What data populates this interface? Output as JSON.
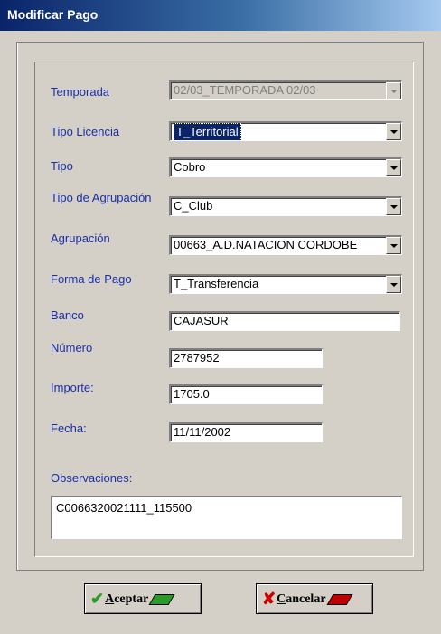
{
  "window": {
    "title": "Modificar Pago"
  },
  "form": {
    "temporada": {
      "label": "Temporada",
      "value": "02/03_TEMPORADA 02/03"
    },
    "tipo_licencia": {
      "label": "Tipo Licencia",
      "value": "T_Territorial"
    },
    "tipo": {
      "label": "Tipo",
      "value": "Cobro"
    },
    "tipo_agrupacion": {
      "label": "Tipo de Agrupación",
      "value": "C_Club"
    },
    "agrupacion": {
      "label": "Agrupación",
      "value": "00663_A.D.NATACION CORDOBE"
    },
    "forma_pago": {
      "label": "Forma de Pago",
      "value": "T_Transferencia"
    },
    "banco": {
      "label": "Banco",
      "value": "CAJASUR"
    },
    "numero": {
      "label": "Número",
      "value": "2787952"
    },
    "importe": {
      "label": "Importe:",
      "value": "1705.0"
    },
    "fecha": {
      "label": "Fecha:",
      "value": "11/11/2002"
    },
    "observaciones": {
      "label": "Observaciones:",
      "value": "C0066320021111_115500"
    }
  },
  "buttons": {
    "accept_first": "A",
    "accept_rest": "ceptar",
    "cancel_first": "C",
    "cancel_rest": "ancelar"
  },
  "icons": {
    "accept": "check-icon",
    "cancel": "x-icon"
  },
  "colors": {
    "title_start": "#0a246a",
    "label": "#1a2ea8",
    "selection": "#0a246a",
    "accept_pen": "#2a9a2a",
    "cancel_pen": "#c00000"
  }
}
